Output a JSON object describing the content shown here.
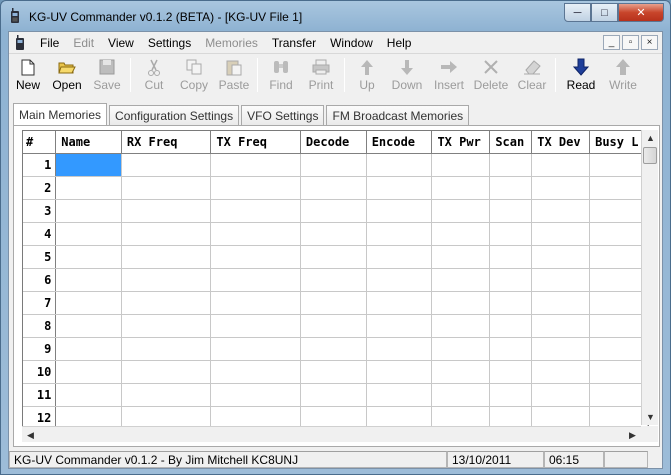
{
  "window": {
    "title": "KG-UV Commander v0.1.2 (BETA) - [KG-UV File 1]",
    "buttons": {
      "minimize": "─",
      "maximize": "□",
      "close": "✕"
    }
  },
  "menubar": {
    "items": [
      {
        "label": "File",
        "enabled": true
      },
      {
        "label": "Edit",
        "enabled": false
      },
      {
        "label": "View",
        "enabled": true
      },
      {
        "label": "Settings",
        "enabled": true
      },
      {
        "label": "Memories",
        "enabled": false
      },
      {
        "label": "Transfer",
        "enabled": true
      },
      {
        "label": "Window",
        "enabled": true
      },
      {
        "label": "Help",
        "enabled": true
      }
    ],
    "mdi_buttons": {
      "minimize": "_",
      "restore": "▫",
      "close": "×"
    }
  },
  "toolbar": {
    "buttons": [
      {
        "label": "New",
        "icon": "new-file-icon",
        "enabled": true
      },
      {
        "label": "Open",
        "icon": "open-folder-icon",
        "enabled": true
      },
      {
        "label": "Save",
        "icon": "save-icon",
        "enabled": false
      },
      {
        "label": "Cut",
        "icon": "cut-icon",
        "enabled": false
      },
      {
        "label": "Copy",
        "icon": "copy-icon",
        "enabled": false
      },
      {
        "label": "Paste",
        "icon": "paste-icon",
        "enabled": false
      },
      {
        "label": "Find",
        "icon": "binoculars-icon",
        "enabled": false
      },
      {
        "label": "Print",
        "icon": "printer-icon",
        "enabled": false
      },
      {
        "label": "Up",
        "icon": "arrow-up-icon",
        "enabled": false
      },
      {
        "label": "Down",
        "icon": "arrow-down-icon",
        "enabled": false
      },
      {
        "label": "Insert",
        "icon": "arrow-right-icon",
        "enabled": false
      },
      {
        "label": "Delete",
        "icon": "delete-x-icon",
        "enabled": false
      },
      {
        "label": "Clear",
        "icon": "eraser-icon",
        "enabled": false
      },
      {
        "label": "Read",
        "icon": "read-arrow-down-icon",
        "enabled": true
      },
      {
        "label": "Write",
        "icon": "write-arrow-up-icon",
        "enabled": false
      }
    ]
  },
  "tabs": [
    {
      "label": "Main Memories",
      "active": true
    },
    {
      "label": "Configuration Settings",
      "active": false
    },
    {
      "label": "VFO Settings",
      "active": false
    },
    {
      "label": "FM Broadcast Memories",
      "active": false
    }
  ],
  "grid": {
    "columns": [
      "#",
      "Name",
      "RX Freq",
      "TX Freq",
      "Decode",
      "Encode",
      "TX Pwr",
      "Scan",
      "TX Dev",
      "Busy L"
    ],
    "rows": [
      "1",
      "2",
      "3",
      "4",
      "5",
      "6",
      "7",
      "8",
      "9",
      "10",
      "11",
      "12"
    ],
    "selected_row": 1,
    "selected_column": "Name"
  },
  "statusbar": {
    "app_text": "KG-UV Commander v0.1.2 - By Jim Mitchell KC8UNJ",
    "date": "13/10/2011",
    "time": "06:15"
  },
  "colors": {
    "selection": "#3399ff",
    "read_icon": "#1f3f9a",
    "title_bar": "#9dbcd8"
  }
}
